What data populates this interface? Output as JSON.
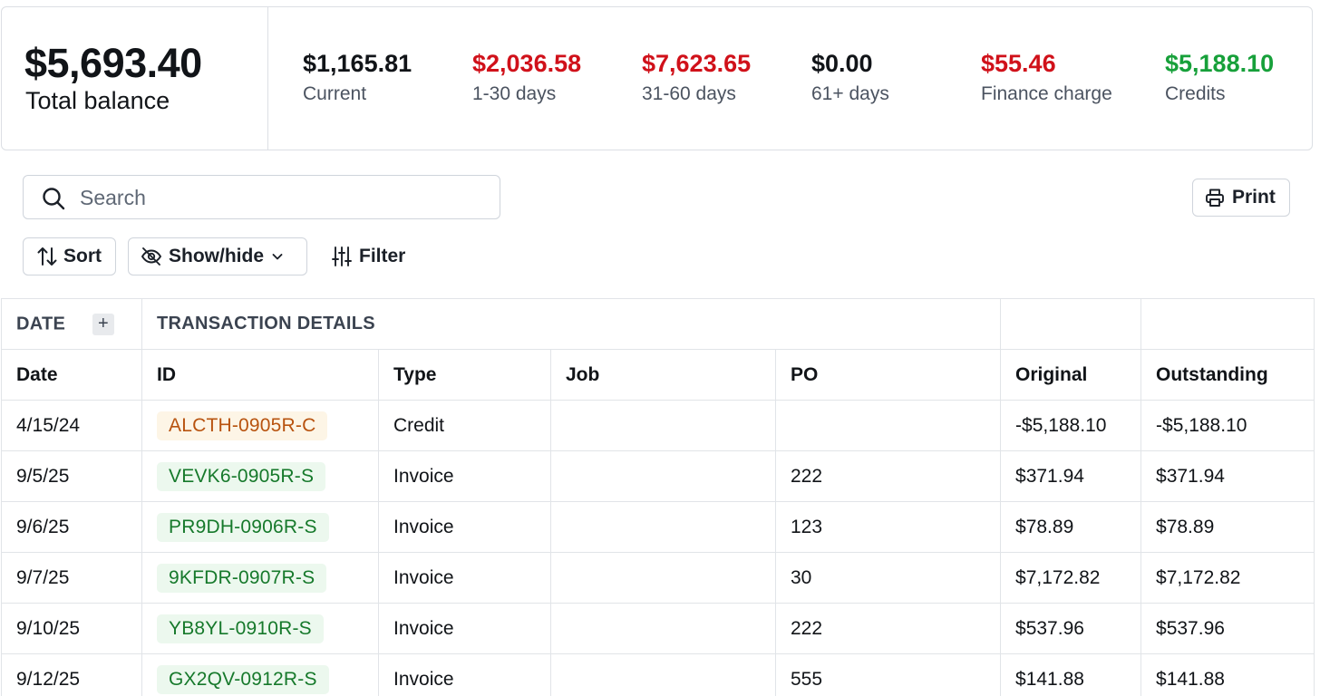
{
  "summary": {
    "total": {
      "amount": "$5,693.40",
      "label": "Total balance"
    },
    "buckets": [
      {
        "amount": "$1,165.81",
        "label": "Current",
        "color": "#111418"
      },
      {
        "amount": "$2,036.58",
        "label": "1-30 days",
        "color": "#d0111a"
      },
      {
        "amount": "$7,623.65",
        "label": "31-60 days",
        "color": "#d0111a"
      },
      {
        "amount": "$0.00",
        "label": "61+ days",
        "color": "#111418"
      },
      {
        "amount": "$55.46",
        "label": "Finance charge",
        "color": "#d0111a"
      },
      {
        "amount": "$5,188.10",
        "label": "Credits",
        "color": "#17a03a"
      }
    ]
  },
  "toolbar": {
    "search_placeholder": "Search",
    "print_label": "Print",
    "sort_label": "Sort",
    "showhide_label": "Show/hide",
    "filter_label": "Filter"
  },
  "table": {
    "group_headers": {
      "date": "DATE",
      "details": "TRANSACTION DETAILS",
      "add_symbol": "+"
    },
    "columns": [
      "Date",
      "ID",
      "Type",
      "Job",
      "PO",
      "Original",
      "Outstanding"
    ],
    "rows": [
      {
        "date": "4/15/24",
        "id": "ALCTH-0905R-C",
        "type": "Credit",
        "job": "",
        "po": "",
        "original": "-$5,188.10",
        "outstanding": "-$5,188.10"
      },
      {
        "date": "9/5/25",
        "id": "VEVK6-0905R-S",
        "type": "Invoice",
        "job": "",
        "po": "222",
        "original": "$371.94",
        "outstanding": "$371.94"
      },
      {
        "date": "9/6/25",
        "id": "PR9DH-0906R-S",
        "type": "Invoice",
        "job": "",
        "po": "123",
        "original": "$78.89",
        "outstanding": "$78.89"
      },
      {
        "date": "9/7/25",
        "id": "9KFDR-0907R-S",
        "type": "Invoice",
        "job": "",
        "po": "30",
        "original": "$7,172.82",
        "outstanding": "$7,172.82"
      },
      {
        "date": "9/10/25",
        "id": "YB8YL-0910R-S",
        "type": "Invoice",
        "job": "",
        "po": "222",
        "original": "$537.96",
        "outstanding": "$537.96"
      },
      {
        "date": "9/12/25",
        "id": "GX2QV-0912R-S",
        "type": "Invoice",
        "job": "",
        "po": "555",
        "original": "$141.88",
        "outstanding": "$141.88"
      }
    ]
  }
}
